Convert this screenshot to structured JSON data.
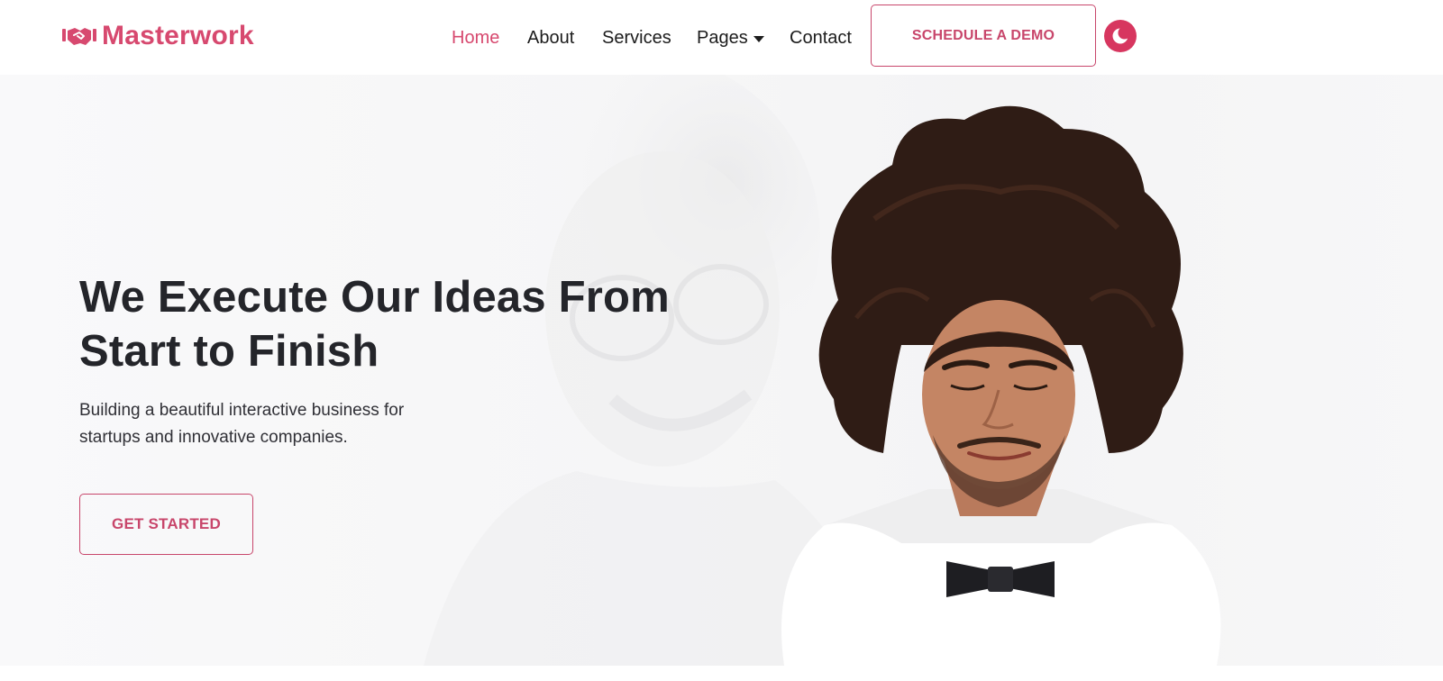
{
  "brand": {
    "name": "Masterwork",
    "icon": "handshake-icon",
    "color": "#d7496f"
  },
  "nav": {
    "items": [
      {
        "label": "Home",
        "active": true
      },
      {
        "label": "About",
        "active": false
      },
      {
        "label": "Services",
        "active": false
      },
      {
        "label": "Pages",
        "active": false,
        "has_dropdown": true
      },
      {
        "label": "Contact",
        "active": false
      }
    ],
    "cta_label": "SCHEDULE A DEMO",
    "theme_toggle_icon": "moon-icon"
  },
  "hero": {
    "title_line1": "We Execute Our Ideas From",
    "title_line2": "Start to Finish",
    "subtitle": "Building a beautiful interactive business for startups and innovative companies.",
    "cta_label": "GET STARTED",
    "image": "man-with-big-hair-bowtie-photo",
    "background_image": "faded-smiling-woman-glasses-photo"
  },
  "colors": {
    "accent": "#d7496f",
    "text": "#24252a",
    "toggle": "#d7365f"
  }
}
